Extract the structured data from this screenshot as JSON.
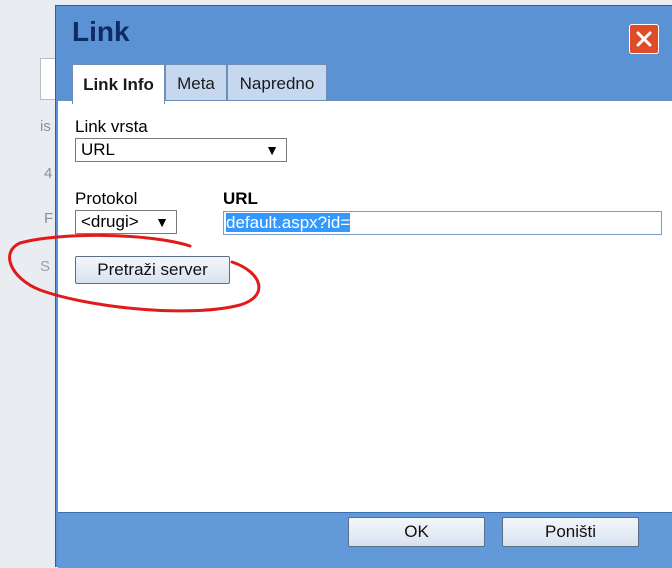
{
  "background": {
    "fragments": [
      "is",
      "4",
      "F",
      "S"
    ]
  },
  "dialog": {
    "title": "Link",
    "close_icon": "close-icon",
    "tabs": [
      {
        "label": "Link Info",
        "active": true
      },
      {
        "label": "Meta",
        "active": false
      },
      {
        "label": "Napredno",
        "active": false
      }
    ],
    "link_type": {
      "label": "Link vrsta",
      "value": "URL"
    },
    "protocol": {
      "label": "Protokol",
      "value": "<drugi>"
    },
    "url": {
      "label": "URL",
      "value": "default.aspx?id="
    },
    "browse_button": "Pretraži server",
    "ok_button": "OK",
    "cancel_button": "Poništi"
  },
  "colors": {
    "dialog_blue": "#5b92d4",
    "title_text": "#0c2c63",
    "close_red": "#e04b2a",
    "selection": "#3399ff",
    "annotation_red": "#e01b1b"
  }
}
